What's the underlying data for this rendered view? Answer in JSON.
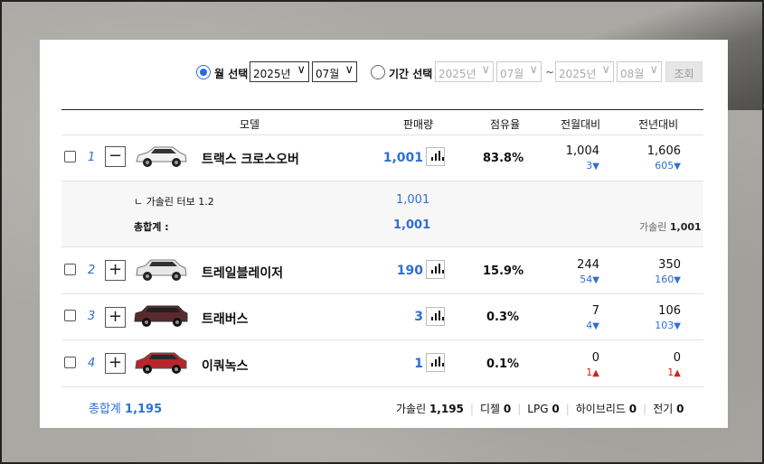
{
  "filters": {
    "monthly_label": "월 선택",
    "monthly_year": "2025년",
    "monthly_month": "07월",
    "period_label": "기간 선택",
    "period_start_year": "2025년",
    "period_start_month": "07월",
    "range_sep": "~",
    "period_end_year": "2025년",
    "period_end_month": "08월",
    "search_label": "조회"
  },
  "columns": {
    "model": "모델",
    "sales": "판매량",
    "share": "점유율",
    "mom": "전월대비",
    "yoy": "전년대비"
  },
  "rows": [
    {
      "rank": "1",
      "model": "트랙스 크로스오버",
      "sales": "1,001",
      "share": "83.8%",
      "mom": "1,004",
      "mom_diff": "3",
      "mom_dir": "▼",
      "yoy": "1,606",
      "yoy_diff": "605",
      "yoy_dir": "▼",
      "toggle": "−"
    },
    {
      "rank": "2",
      "model": "트레일블레이저",
      "sales": "190",
      "share": "15.9%",
      "mom": "244",
      "mom_diff": "54",
      "mom_dir": "▼",
      "yoy": "350",
      "yoy_diff": "160",
      "yoy_dir": "▼",
      "toggle": "+"
    },
    {
      "rank": "3",
      "model": "트래버스",
      "sales": "3",
      "share": "0.3%",
      "mom": "7",
      "mom_diff": "4",
      "mom_dir": "▼",
      "yoy": "106",
      "yoy_diff": "103",
      "yoy_dir": "▼",
      "toggle": "+"
    },
    {
      "rank": "4",
      "model": "이쿼녹스",
      "sales": "1",
      "share": "0.1%",
      "mom": "0",
      "mom_diff": "1",
      "mom_dir": "▲",
      "yoy": "0",
      "yoy_diff": "1",
      "yoy_dir": "▲",
      "toggle": "+"
    }
  ],
  "detail": {
    "trim_label": "ㄴ 가솔린 터보 1.2",
    "trim_sales": "1,001",
    "subtotal_label": "총합계 :",
    "subtotal_sales": "1,001",
    "fuel_label": "가솔린",
    "fuel_value": "1,001"
  },
  "footer": {
    "total_label": "총합계",
    "total_value": "1,195",
    "fuel": [
      {
        "label": "가솔린",
        "value": "1,195"
      },
      {
        "label": "디젤",
        "value": "0"
      },
      {
        "label": "LPG",
        "value": "0"
      },
      {
        "label": "하이브리드",
        "value": "0"
      },
      {
        "label": "전기",
        "value": "0"
      }
    ]
  },
  "colors": {
    "accent": "#2f6ed6",
    "down": "#2f6ed6",
    "up": "#d21f1f"
  }
}
